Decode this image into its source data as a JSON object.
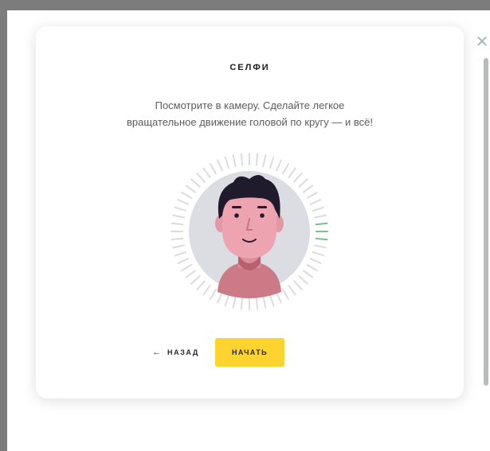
{
  "modal": {
    "close_icon": "close-icon",
    "close_glyph": "✕"
  },
  "card": {
    "title": "СЕЛФИ",
    "instruction_line1": "Посмотрите в камеру. Сделайте легкое",
    "instruction_line2": "вращательное движение головой по кругу — и всё!"
  },
  "progress": {
    "completed_segments": 3,
    "total_segments": 60,
    "active_color": "#7cbf88",
    "inactive_color": "#dcdcdc"
  },
  "buttons": {
    "back_label": "НАЗАД",
    "back_icon": "arrow-left-icon",
    "start_label": "НАЧАТЬ",
    "start_color": "#fdd330"
  }
}
